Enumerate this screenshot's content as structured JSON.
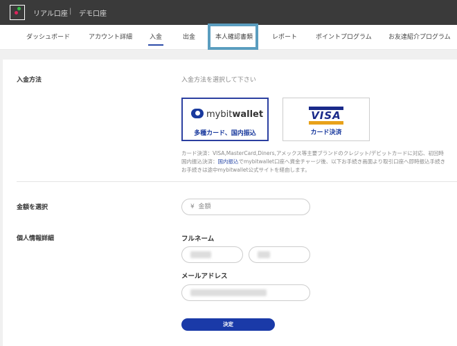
{
  "header": {
    "real_account": "リアル口座",
    "separator": "|",
    "demo_account": "デモ口座"
  },
  "nav": {
    "items": [
      {
        "label": "ダッシュボード"
      },
      {
        "label": "アカウント詳細"
      },
      {
        "label": "入金"
      },
      {
        "label": "出金"
      },
      {
        "label": "本人確認書類"
      },
      {
        "label": "レポート"
      },
      {
        "label": "ポイントプログラム"
      },
      {
        "label": "お友達紹介プログラム"
      }
    ],
    "active": "入金",
    "highlighted": "本人確認書類"
  },
  "deposit_method": {
    "label": "入金方法",
    "hint": "入金方法を選択して下さい",
    "options": [
      {
        "brand": "mybitwallet",
        "brand_light": "mybit",
        "brand_bold": "wallet",
        "caption": "多種カード、国内振込",
        "selected": true
      },
      {
        "brand": "VISA",
        "caption": "カード決済",
        "selected": false
      }
    ],
    "description": {
      "line1": "カード決済：VISA,MasterCard,Diners,アメックス等主要ブランドのクレジット/デビットカードに対応、初回時",
      "line2_prefix": "国内振込決済：",
      "line2_link": "国内振込",
      "line2_suffix": "でmybitwallet口座へ資金チャージ後、以下お手続き画面より取引口座へ即時振込手続き",
      "line3": "お手続きは途中mybitwallet公式サイトを経由します。"
    }
  },
  "amount": {
    "label": "金額を選択",
    "currency_symbol": "¥",
    "placeholder": "金額"
  },
  "personal": {
    "label": "個人情報詳細",
    "fullname_label": "フルネーム",
    "email_label": "メールアドレス"
  },
  "submit_label": "決定",
  "colors": {
    "topbar": "#3a3a3a",
    "accent": "#1a3aa8",
    "highlight_box": "#5a9dbf"
  }
}
